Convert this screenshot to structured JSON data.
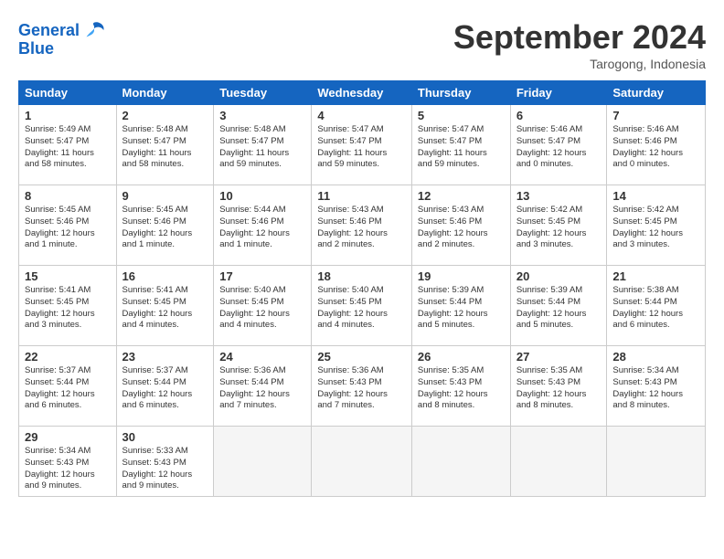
{
  "logo": {
    "line1": "General",
    "line2": "Blue"
  },
  "title": "September 2024",
  "subtitle": "Tarogong, Indonesia",
  "headers": [
    "Sunday",
    "Monday",
    "Tuesday",
    "Wednesday",
    "Thursday",
    "Friday",
    "Saturday"
  ],
  "weeks": [
    [
      {
        "day": "1",
        "info": "Sunrise: 5:49 AM\nSunset: 5:47 PM\nDaylight: 11 hours\nand 58 minutes."
      },
      {
        "day": "2",
        "info": "Sunrise: 5:48 AM\nSunset: 5:47 PM\nDaylight: 11 hours\nand 58 minutes."
      },
      {
        "day": "3",
        "info": "Sunrise: 5:48 AM\nSunset: 5:47 PM\nDaylight: 11 hours\nand 59 minutes."
      },
      {
        "day": "4",
        "info": "Sunrise: 5:47 AM\nSunset: 5:47 PM\nDaylight: 11 hours\nand 59 minutes."
      },
      {
        "day": "5",
        "info": "Sunrise: 5:47 AM\nSunset: 5:47 PM\nDaylight: 11 hours\nand 59 minutes."
      },
      {
        "day": "6",
        "info": "Sunrise: 5:46 AM\nSunset: 5:47 PM\nDaylight: 12 hours\nand 0 minutes."
      },
      {
        "day": "7",
        "info": "Sunrise: 5:46 AM\nSunset: 5:46 PM\nDaylight: 12 hours\nand 0 minutes."
      }
    ],
    [
      {
        "day": "8",
        "info": "Sunrise: 5:45 AM\nSunset: 5:46 PM\nDaylight: 12 hours\nand 1 minute."
      },
      {
        "day": "9",
        "info": "Sunrise: 5:45 AM\nSunset: 5:46 PM\nDaylight: 12 hours\nand 1 minute."
      },
      {
        "day": "10",
        "info": "Sunrise: 5:44 AM\nSunset: 5:46 PM\nDaylight: 12 hours\nand 1 minute."
      },
      {
        "day": "11",
        "info": "Sunrise: 5:43 AM\nSunset: 5:46 PM\nDaylight: 12 hours\nand 2 minutes."
      },
      {
        "day": "12",
        "info": "Sunrise: 5:43 AM\nSunset: 5:46 PM\nDaylight: 12 hours\nand 2 minutes."
      },
      {
        "day": "13",
        "info": "Sunrise: 5:42 AM\nSunset: 5:45 PM\nDaylight: 12 hours\nand 3 minutes."
      },
      {
        "day": "14",
        "info": "Sunrise: 5:42 AM\nSunset: 5:45 PM\nDaylight: 12 hours\nand 3 minutes."
      }
    ],
    [
      {
        "day": "15",
        "info": "Sunrise: 5:41 AM\nSunset: 5:45 PM\nDaylight: 12 hours\nand 3 minutes."
      },
      {
        "day": "16",
        "info": "Sunrise: 5:41 AM\nSunset: 5:45 PM\nDaylight: 12 hours\nand 4 minutes."
      },
      {
        "day": "17",
        "info": "Sunrise: 5:40 AM\nSunset: 5:45 PM\nDaylight: 12 hours\nand 4 minutes."
      },
      {
        "day": "18",
        "info": "Sunrise: 5:40 AM\nSunset: 5:45 PM\nDaylight: 12 hours\nand 4 minutes."
      },
      {
        "day": "19",
        "info": "Sunrise: 5:39 AM\nSunset: 5:44 PM\nDaylight: 12 hours\nand 5 minutes."
      },
      {
        "day": "20",
        "info": "Sunrise: 5:39 AM\nSunset: 5:44 PM\nDaylight: 12 hours\nand 5 minutes."
      },
      {
        "day": "21",
        "info": "Sunrise: 5:38 AM\nSunset: 5:44 PM\nDaylight: 12 hours\nand 6 minutes."
      }
    ],
    [
      {
        "day": "22",
        "info": "Sunrise: 5:37 AM\nSunset: 5:44 PM\nDaylight: 12 hours\nand 6 minutes."
      },
      {
        "day": "23",
        "info": "Sunrise: 5:37 AM\nSunset: 5:44 PM\nDaylight: 12 hours\nand 6 minutes."
      },
      {
        "day": "24",
        "info": "Sunrise: 5:36 AM\nSunset: 5:44 PM\nDaylight: 12 hours\nand 7 minutes."
      },
      {
        "day": "25",
        "info": "Sunrise: 5:36 AM\nSunset: 5:43 PM\nDaylight: 12 hours\nand 7 minutes."
      },
      {
        "day": "26",
        "info": "Sunrise: 5:35 AM\nSunset: 5:43 PM\nDaylight: 12 hours\nand 8 minutes."
      },
      {
        "day": "27",
        "info": "Sunrise: 5:35 AM\nSunset: 5:43 PM\nDaylight: 12 hours\nand 8 minutes."
      },
      {
        "day": "28",
        "info": "Sunrise: 5:34 AM\nSunset: 5:43 PM\nDaylight: 12 hours\nand 8 minutes."
      }
    ],
    [
      {
        "day": "29",
        "info": "Sunrise: 5:34 AM\nSunset: 5:43 PM\nDaylight: 12 hours\nand 9 minutes."
      },
      {
        "day": "30",
        "info": "Sunrise: 5:33 AM\nSunset: 5:43 PM\nDaylight: 12 hours\nand 9 minutes."
      },
      {
        "day": "",
        "info": ""
      },
      {
        "day": "",
        "info": ""
      },
      {
        "day": "",
        "info": ""
      },
      {
        "day": "",
        "info": ""
      },
      {
        "day": "",
        "info": ""
      }
    ]
  ]
}
